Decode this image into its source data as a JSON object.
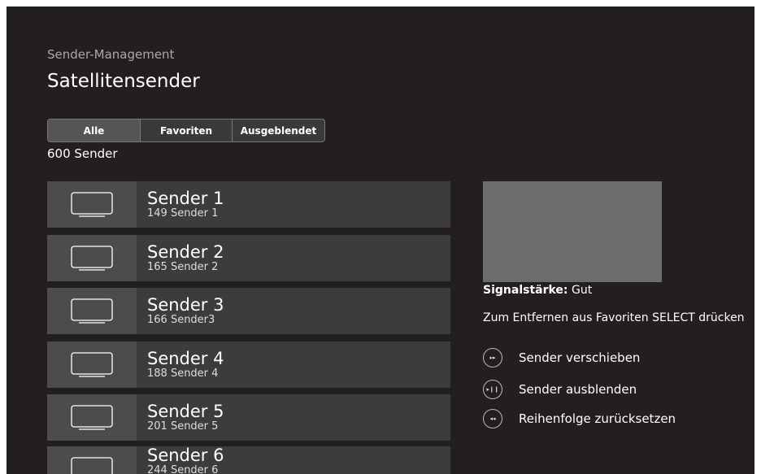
{
  "breadcrumb": "Sender-Management",
  "page_title": "Satellitensender",
  "tabs": [
    {
      "label": "Alle",
      "active": true
    },
    {
      "label": "Favoriten",
      "active": false
    },
    {
      "label": "Ausgeblendet",
      "active": false
    }
  ],
  "channel_count": "600 Sender",
  "channels": [
    {
      "name": "Sender 1",
      "number": "149 Sender 1"
    },
    {
      "name": "Sender 2",
      "number": "165 Sender 2"
    },
    {
      "name": "Sender 3",
      "number": "166 Sender3"
    },
    {
      "name": "Sender 4",
      "number": "188 Sender 4"
    },
    {
      "name": "Sender 5",
      "number": "201 Sender 5"
    },
    {
      "name": "Sender 6",
      "number": "244 Sender 6"
    }
  ],
  "info": {
    "signal_label": "Signalstärke:",
    "signal_value": "Gut",
    "hint": "Zum Entfernen aus Favoriten SELECT drücken"
  },
  "actions": [
    {
      "icon": "fast-forward-icon",
      "glyph": "▸▸",
      "label": "Sender verschieben"
    },
    {
      "icon": "play-pause-icon",
      "glyph": "▸❙❙",
      "label": "Sender ausblenden"
    },
    {
      "icon": "rewind-icon",
      "glyph": "◂◂",
      "label": "Reihenfolge zurücksetzen"
    }
  ],
  "colors": {
    "background": "#231f20",
    "row": "#3c3c3c",
    "row_thumb": "#4c4c4c",
    "preview": "#6c6c6c"
  }
}
